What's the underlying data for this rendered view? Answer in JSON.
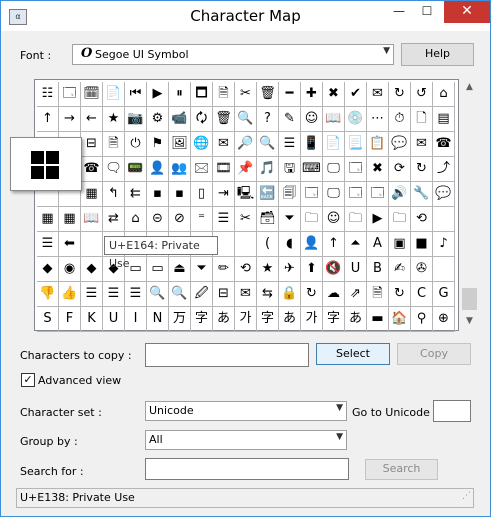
{
  "window": {
    "title": "Character Map",
    "app_icon": "character-map-icon",
    "close_glyph": "✕"
  },
  "font_row": {
    "label": "Font :",
    "font_icon": "O",
    "font_name": "Segoe UI Symbol",
    "help_label": "Help"
  },
  "grid": {
    "rows": [
      [
        "☷",
        "🗔",
        "🗓",
        "📄",
        "⏮",
        "▶",
        "⏸",
        "🗖",
        "🗎",
        "✂",
        "🗑",
        "━",
        "✚",
        "✖",
        "✔",
        "✉",
        "↻",
        "↺",
        "⌂"
      ],
      [
        "↑",
        "→",
        "←",
        "★",
        "📷",
        "⚙",
        "📹",
        "🗘",
        "🗑",
        "🔍",
        "?",
        "✎",
        "☺",
        "📖",
        "💿",
        "⋯",
        "⏱",
        "🗋",
        "▤"
      ],
      [
        "",
        "",
        "⊟",
        "🗎",
        "⏻",
        "⚑",
        "🖼",
        "🌐",
        "✉",
        "🔎",
        "🔍",
        "☰",
        "📱",
        "📄",
        "📃",
        "📋",
        "💬",
        "✉",
        "☎"
      ],
      [
        "",
        "",
        "☎",
        "🗨",
        "📟",
        "👤",
        "👥",
        "🖂",
        "🎞",
        "📌",
        "🎵",
        "🖫",
        "⌨",
        "🖵",
        "🗔",
        "✖",
        "⟳",
        "↻",
        "⤴"
      ],
      [
        "",
        "",
        "▦",
        "↰",
        "⇇",
        "▪",
        "▪",
        "▯",
        "⇥",
        "🖳",
        "🔙",
        "🗐",
        "🗔",
        "🖵",
        "🗔",
        "🗔",
        "🔊",
        "🔧",
        "💬"
      ],
      [
        "▦",
        "▦",
        "📖",
        "⇄",
        "⌂",
        "⊝",
        "⊘",
        "⁼",
        "☰",
        "✂",
        "🗃",
        "⏷",
        "🗀",
        "☺",
        "🗀",
        "▶",
        "🗀",
        "⟲",
        ""
      ],
      [
        "☰",
        "⬅",
        "",
        "",
        "",
        "",
        "",
        "",
        "",
        "",
        "(",
        "◖",
        "👤",
        "↑",
        "⏶",
        "A",
        "▣",
        "■",
        "♪"
      ],
      [
        "◆",
        "◉",
        "◆",
        "◆",
        "▭",
        "▭",
        "⏏",
        "⏷",
        "✏",
        "⟲",
        "★",
        "✈",
        "⬆",
        "🔇",
        "U",
        "B",
        "✍",
        "✇",
        ""
      ],
      [
        "👎",
        "👍",
        "☰",
        "☰",
        "☰",
        "🔍",
        "🔍",
        "🖉",
        "⊟",
        "✉",
        "⇆",
        "🔒",
        "↻",
        "☁",
        "⇗",
        "🗎",
        "↻",
        "C",
        "G"
      ],
      [
        "S",
        "F",
        "K",
        "U",
        "I",
        "N",
        "万",
        "字",
        "あ",
        "가",
        "字",
        "あ",
        "가",
        "字",
        "あ",
        "▬",
        "🏠",
        "⚲",
        "⊕"
      ]
    ]
  },
  "zoom_preview": {
    "icon": "grid-four-squares-icon"
  },
  "tooltip": {
    "text": "U+E164: Private Use"
  },
  "copy_row": {
    "label": "Characters to copy :",
    "value": "",
    "select_label": "Select",
    "copy_label": "Copy"
  },
  "advanced": {
    "checked": true,
    "check_glyph": "✓",
    "label": "Advanced view"
  },
  "charset": {
    "label": "Character set :",
    "value": "Unicode",
    "goto_label": "Go to Unicode :",
    "goto_value": ""
  },
  "groupby": {
    "label": "Group by :",
    "value": "All"
  },
  "search": {
    "label": "Search for :",
    "value": "",
    "button_label": "Search"
  },
  "status": {
    "text": "U+E138: Private Use"
  }
}
